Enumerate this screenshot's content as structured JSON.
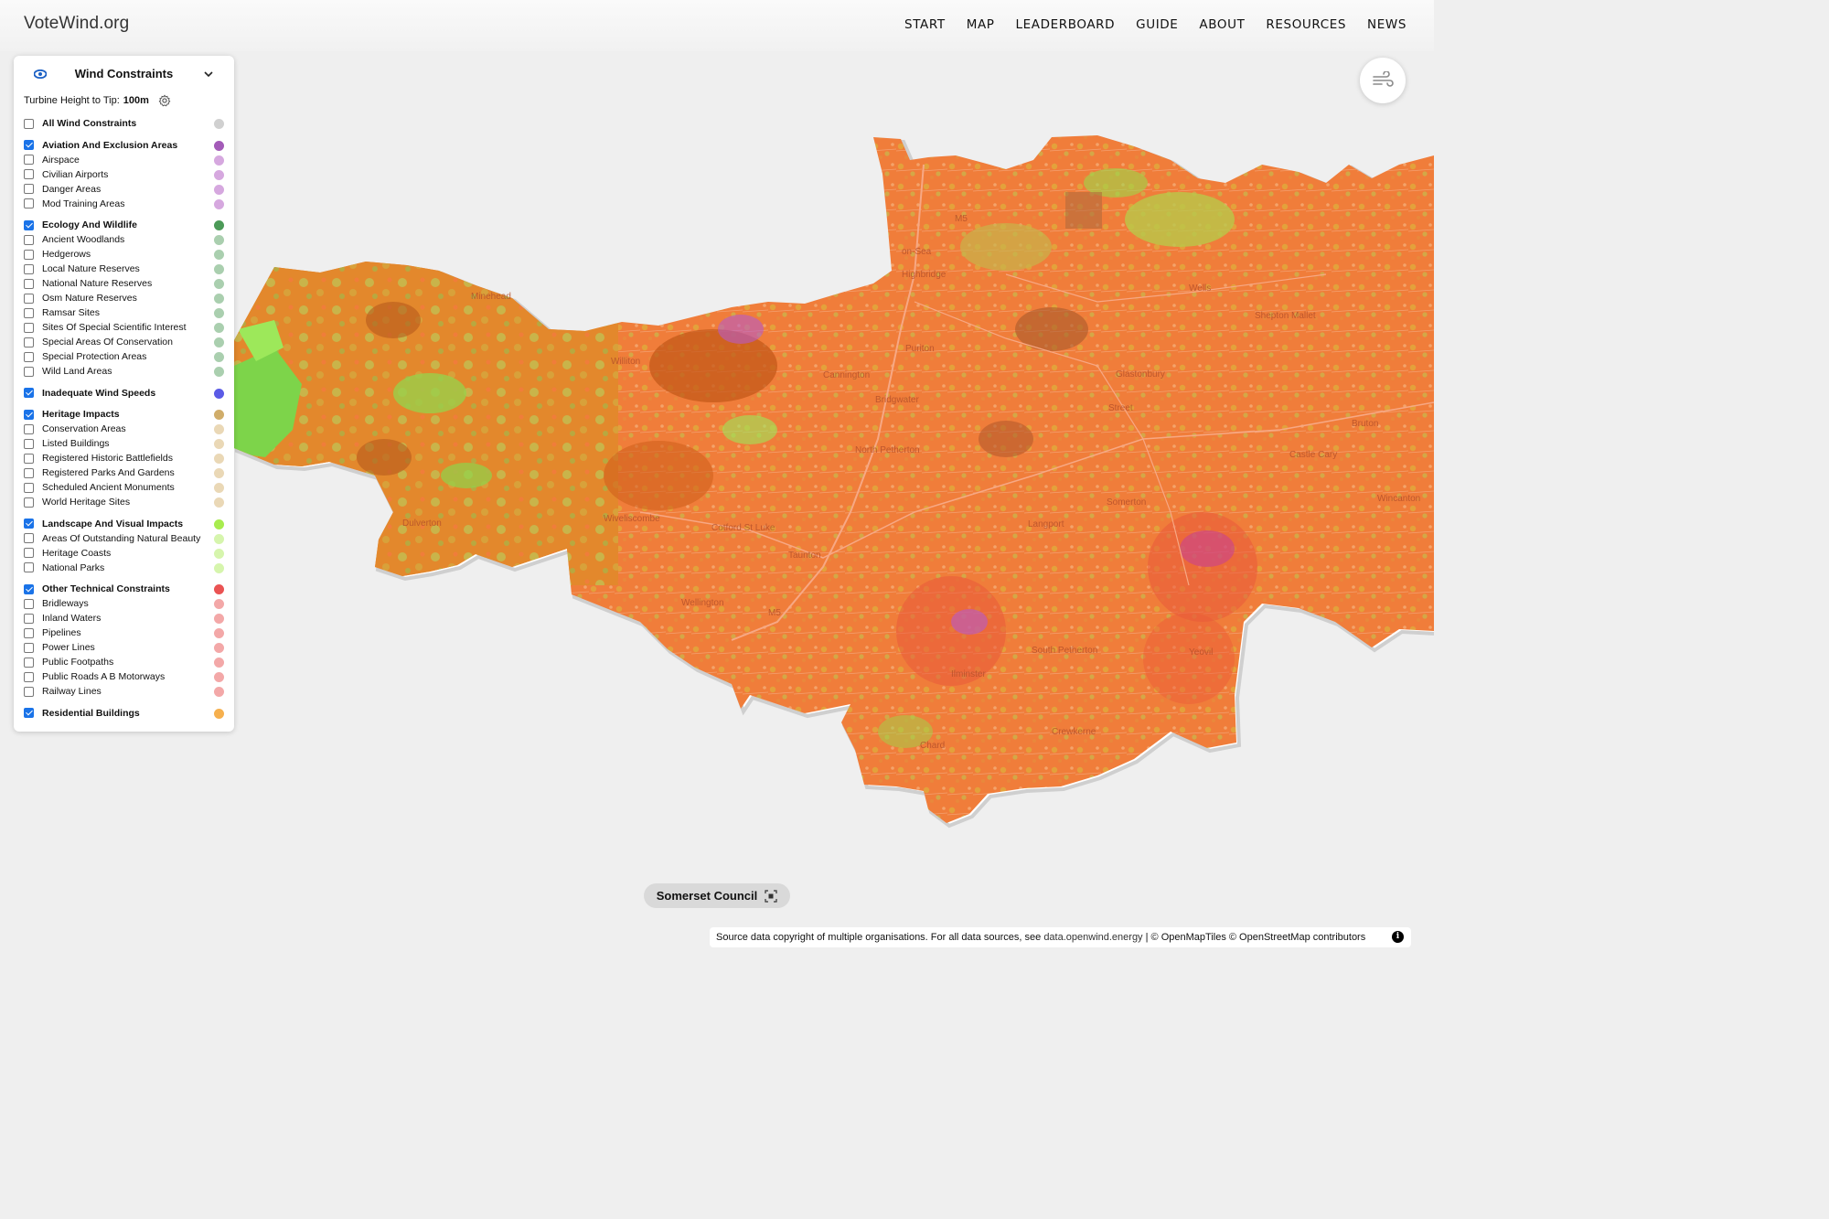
{
  "header": {
    "brand": "VoteWind.org",
    "nav": [
      "START",
      "MAP",
      "LEADERBOARD",
      "GUIDE",
      "ABOUT",
      "RESOURCES",
      "NEWS"
    ]
  },
  "panel": {
    "title": "Wind Constraints",
    "turbine_label": "Turbine Height to Tip:",
    "turbine_value": "100m",
    "groups": [
      {
        "label": "All Wind Constraints",
        "checked": false,
        "color": "#d0d0d0",
        "items": []
      },
      {
        "label": "Aviation And Exclusion Areas",
        "checked": true,
        "color": "#a35bb8",
        "items": [
          "Airspace",
          "Civilian Airports",
          "Danger Areas",
          "Mod Training Areas"
        ],
        "item_color": "#d6a8df"
      },
      {
        "label": "Ecology And Wildlife",
        "checked": true,
        "color": "#4c9a58",
        "items": [
          "Ancient Woodlands",
          "Hedgerows",
          "Local Nature Reserves",
          "National Nature Reserves",
          "Osm Nature Reserves",
          "Ramsar Sites",
          "Sites Of Special Scientific Interest",
          "Special Areas Of Conservation",
          "Special Protection Areas",
          "Wild Land Areas"
        ],
        "item_color": "#aacfaf"
      },
      {
        "label": "Inadequate Wind Speeds",
        "checked": true,
        "color": "#5b5be6",
        "items": []
      },
      {
        "label": "Heritage Impacts",
        "checked": true,
        "color": "#d0ad6a",
        "items": [
          "Conservation Areas",
          "Listed Buildings",
          "Registered Historic Battlefields",
          "Registered Parks And Gardens",
          "Scheduled Ancient Monuments",
          "World Heritage Sites"
        ],
        "item_color": "#ead8b6"
      },
      {
        "label": "Landscape And Visual Impacts",
        "checked": true,
        "color": "#a8ec4f",
        "items": [
          "Areas Of Outstanding Natural Beauty",
          "Heritage Coasts",
          "National Parks"
        ],
        "item_color": "#d6f5ad"
      },
      {
        "label": "Other Technical Constraints",
        "checked": true,
        "color": "#ea5353",
        "items": [
          "Bridleways",
          "Inland Waters",
          "Pipelines",
          "Power Lines",
          "Public Footpaths",
          "Public Roads A B Motorways",
          "Railway Lines"
        ],
        "item_color": "#f3a8a8"
      },
      {
        "label": "Residential Buildings",
        "checked": true,
        "color": "#f6b04e",
        "items": []
      }
    ]
  },
  "map": {
    "place_labels": [
      "Minehead",
      "Watchet",
      "Williton",
      "Cannington",
      "Bridgwater",
      "North Petherton",
      "Wiveliscombe",
      "Taunton",
      "Wellington",
      "Langport",
      "Somerton",
      "Street",
      "Glastonbury",
      "Wells",
      "Shepton Mallet",
      "Bruton",
      "Castle Cary",
      "Wincanton",
      "Ilminster",
      "South Petherton",
      "Yeovil",
      "Crewkerne",
      "Chard",
      "Burnham-on-Sea",
      "Highbridge",
      "M5",
      "Puriton",
      "Dulverton",
      "Cotford St Luke",
      "Bishops Lydeard"
    ]
  },
  "council": "Somerset Council",
  "attribution": {
    "text": "Source data copyright of multiple organisations. For all data sources, see",
    "link": "data.openwind.energy",
    "rest": "| © OpenMapTiles © OpenStreetMap contributors"
  },
  "colors": {
    "base": "#f07d3a",
    "dark": "#d9641f",
    "mid": "#e9a23a",
    "olive": "#c9b44a",
    "green": "#7dd44a",
    "bright_green": "#9de85a",
    "accent": "#1a73e8"
  }
}
